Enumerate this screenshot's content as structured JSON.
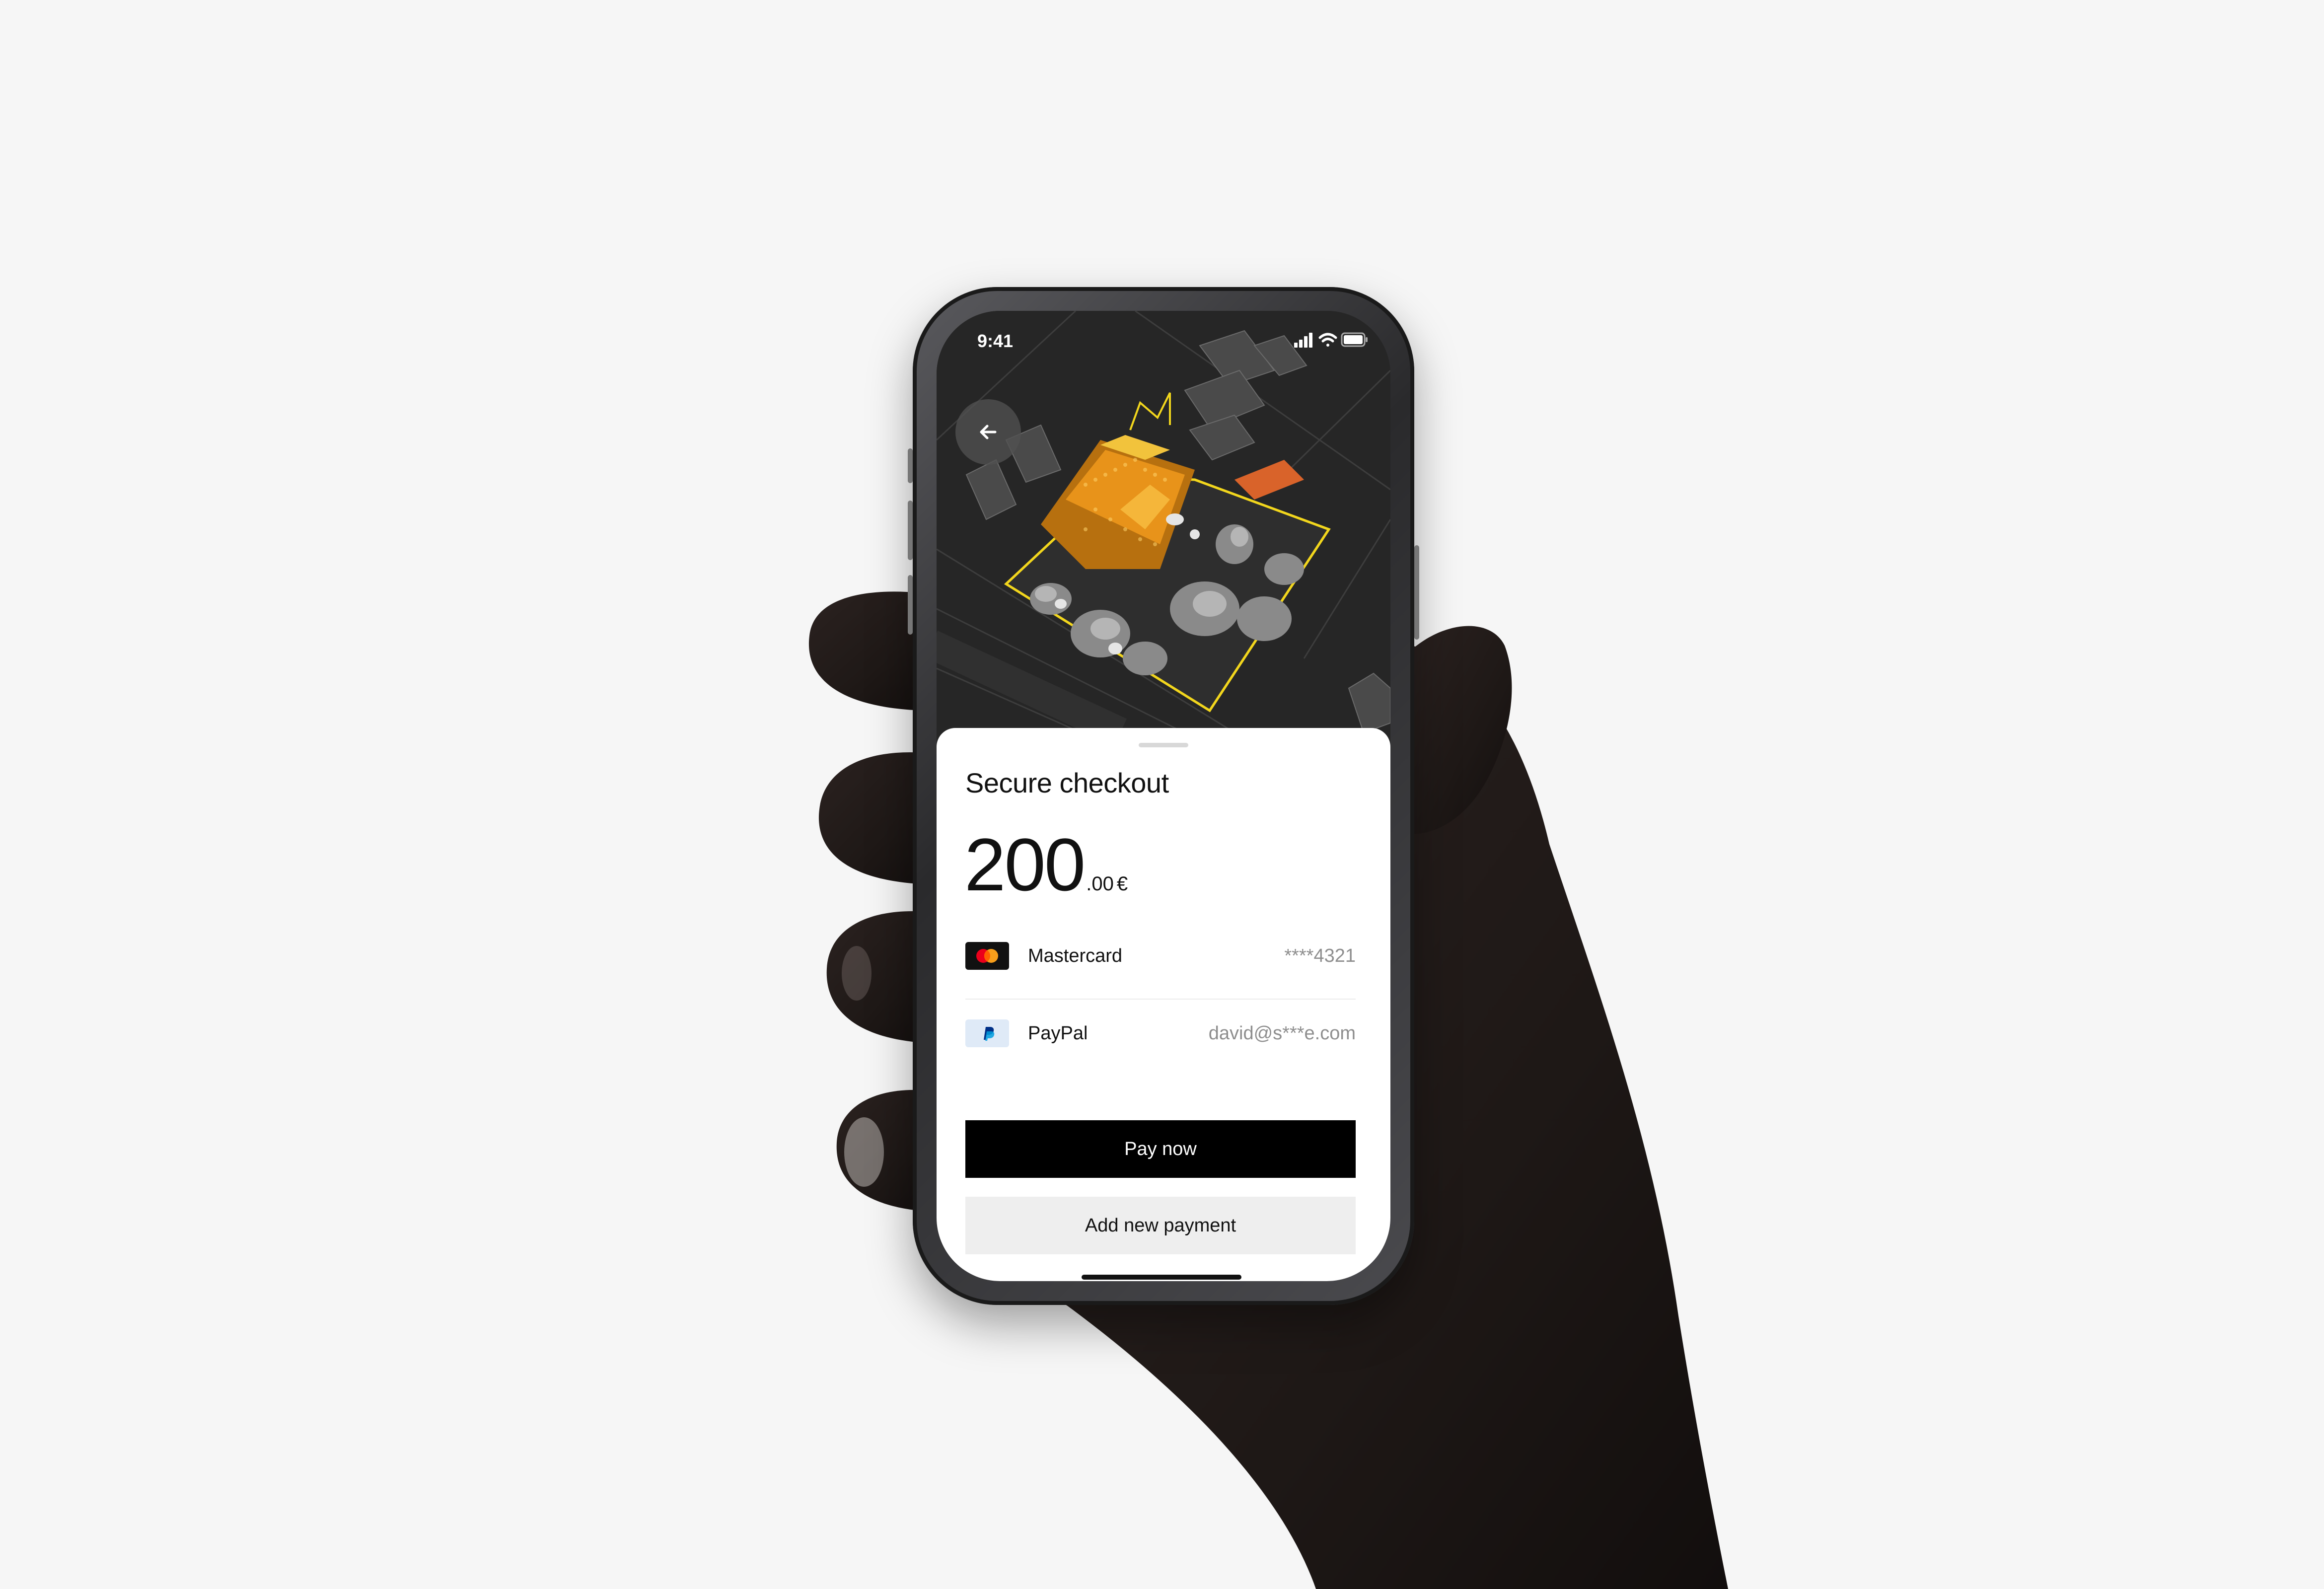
{
  "status_bar": {
    "time": "9:41"
  },
  "sheet": {
    "title": "Secure checkout",
    "amount": {
      "major": "200",
      "minor": ".00",
      "currency": "€"
    },
    "payment_methods": [
      {
        "name": "Mastercard",
        "detail": "****4321",
        "icon": "mastercard-icon"
      },
      {
        "name": "PayPal",
        "detail": "david@s***e.com",
        "icon": "paypal-icon"
      }
    ],
    "pay_label": "Pay now",
    "add_label": "Add new payment"
  },
  "colors": {
    "background": "#f6f6f6",
    "map_background": "#262626",
    "highlight_outline": "#f2d61d",
    "roof_orange": "#e8931a",
    "primary_button": "#000000",
    "secondary_button": "#eeeeee"
  }
}
